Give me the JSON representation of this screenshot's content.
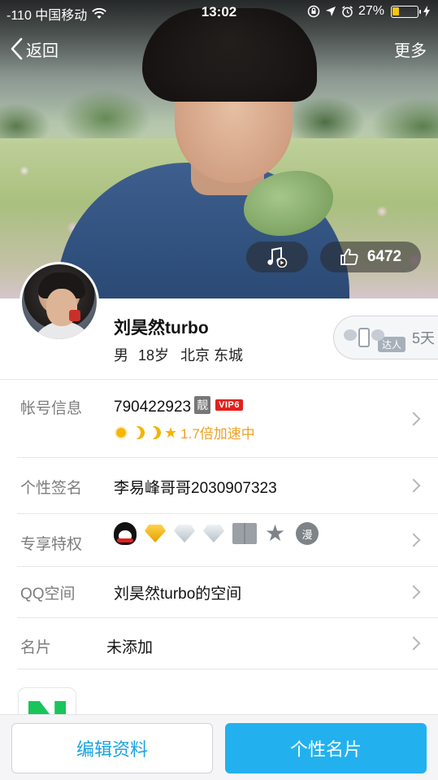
{
  "status_bar": {
    "carrier": "-110 中国移动",
    "time": "13:02",
    "battery_percent": "27%",
    "battery_level": 0.27
  },
  "nav": {
    "back_label": "返回",
    "more_label": "更多"
  },
  "hero": {
    "like_count": "6472"
  },
  "profile": {
    "nickname": "刘昊然turbo",
    "gender": "男",
    "age": "18岁",
    "location": "北京 东城",
    "daren_tag": "达人",
    "daren_days": "5天"
  },
  "rows": {
    "account": {
      "label": "帐号信息",
      "qq_number": "790422923",
      "liang_badge": "靓",
      "vip_badge": "VIP6",
      "speed_text": "1.7倍加速中"
    },
    "signature": {
      "label": "个性签名",
      "value": "李易峰哥哥2030907323"
    },
    "privileges": {
      "label": "专享特权",
      "chat_badge": "漫"
    },
    "qzone": {
      "label": "QQ空间",
      "value": "刘昊然turbo的空间"
    },
    "card": {
      "label": "名片",
      "value": "未添加"
    }
  },
  "buttons": {
    "edit_profile": "编辑资料",
    "personal_card": "个性名片"
  },
  "colors": {
    "accent": "#22b1ee",
    "vip_red": "#e3201b",
    "level_orange": "#f0a020"
  }
}
